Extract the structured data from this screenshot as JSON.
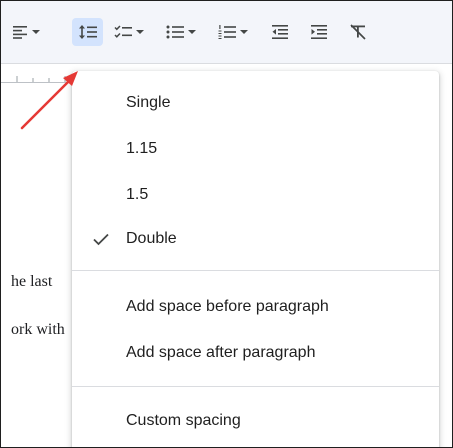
{
  "toolbar": {
    "buttons": [
      {
        "name": "align",
        "icon": "align-left-icon",
        "has_dropdown": true
      },
      {
        "name": "line-spacing",
        "icon": "line-spacing-icon",
        "has_dropdown": false,
        "active": true
      },
      {
        "name": "checklist",
        "icon": "checklist-icon",
        "has_dropdown": true
      },
      {
        "name": "bulleted-list",
        "icon": "bulleted-list-icon",
        "has_dropdown": true
      },
      {
        "name": "numbered-list",
        "icon": "numbered-list-icon",
        "has_dropdown": true
      },
      {
        "name": "decrease-indent",
        "icon": "decrease-indent-icon",
        "has_dropdown": false
      },
      {
        "name": "increase-indent",
        "icon": "increase-indent-icon",
        "has_dropdown": false
      },
      {
        "name": "clear-formatting",
        "icon": "clear-formatting-icon",
        "has_dropdown": false
      }
    ]
  },
  "document": {
    "lines": [
      "he last",
      "ork with"
    ]
  },
  "line_spacing_menu": {
    "options": [
      {
        "label": "Single",
        "checked": false
      },
      {
        "label": "1.15",
        "checked": false
      },
      {
        "label": "1.5",
        "checked": false
      },
      {
        "label": "Double",
        "checked": true
      }
    ],
    "paragraph_options": [
      {
        "label": "Add space before paragraph"
      },
      {
        "label": "Add space after paragraph"
      }
    ],
    "custom": {
      "label": "Custom spacing"
    }
  },
  "annotation": {
    "arrow_color": "#e53935",
    "arrow_icon": "red-arrow-annotation"
  },
  "colors": {
    "toolbar_bg": "#f3f5fa",
    "active_button_bg": "#d3e3fd",
    "icon": "#444746",
    "menu_text": "#1f1f1f"
  }
}
